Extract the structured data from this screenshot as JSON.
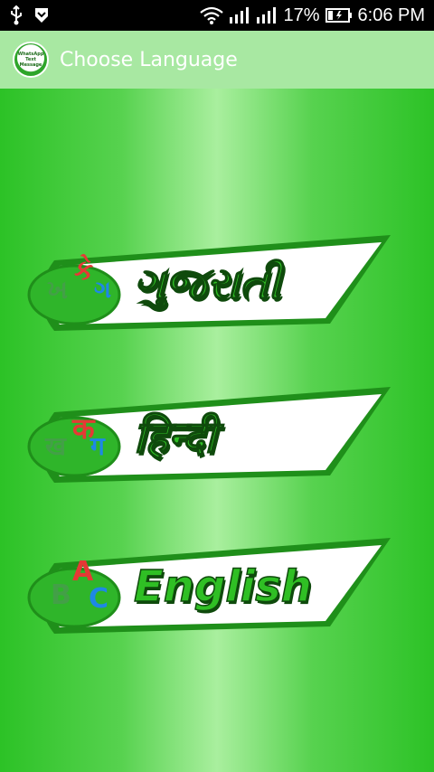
{
  "status_bar": {
    "battery_percent": "17%",
    "time": "6:06 PM",
    "icons": [
      "usb-icon",
      "download-icon",
      "wifi-icon",
      "signal-icon",
      "signal-icon",
      "battery-icon"
    ]
  },
  "action_bar": {
    "app_icon_text_line1": "WhatsApp",
    "app_icon_text_line2": "Text",
    "app_icon_text_line3": "Message",
    "title": "Choose Language"
  },
  "languages": [
    {
      "label": "ગુજરાતી",
      "glyphs": [
        "કે",
        "ખ",
        "ગ"
      ],
      "glyph_colors": [
        "#e53935",
        "#43a047",
        "#1e88e5"
      ]
    },
    {
      "label": "हिन्दी",
      "glyphs": [
        "क",
        "ख",
        "ग"
      ],
      "glyph_colors": [
        "#e53935",
        "#43a047",
        "#1e88e5"
      ]
    },
    {
      "label": "English",
      "glyphs": [
        "A",
        "B",
        "C"
      ],
      "glyph_colors": [
        "#e53935",
        "#43a047",
        "#1e88e5"
      ]
    }
  ],
  "colors": {
    "action_bar": "#a8e8a2",
    "content_green": "#2cc226",
    "button_border": "#1f8f1a"
  }
}
